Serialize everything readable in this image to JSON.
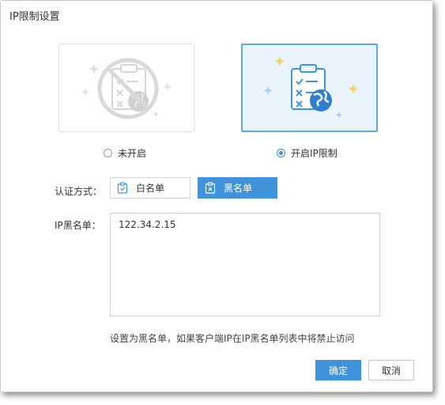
{
  "dialog": {
    "title": "IP限制设置"
  },
  "options": {
    "off_label": "未开启",
    "on_label": "开启IP限制",
    "selected": "on"
  },
  "auth": {
    "label": "认证方式：",
    "whitelist_label": "白名单",
    "blacklist_label": "黑名单",
    "selected": "blacklist"
  },
  "blacklist": {
    "label": "IP黑名单：",
    "value": "122.34.2.15"
  },
  "hint": "设置为黑名单，如果客户端IP在IP黑名单列表中将禁止访问",
  "buttons": {
    "ok_label": "确定",
    "cancel_label": "取消"
  },
  "colors": {
    "accent": "#3f93dd",
    "card_selected_bg": "#eaf4fd",
    "card_selected_border": "#5aa9ea"
  },
  "icons": {
    "off_card": "disabled-clipboard-globe-icon",
    "on_card": "clipboard-globe-icon",
    "whitelist": "clipboard-check-icon",
    "blacklist": "clipboard-x-icon"
  }
}
